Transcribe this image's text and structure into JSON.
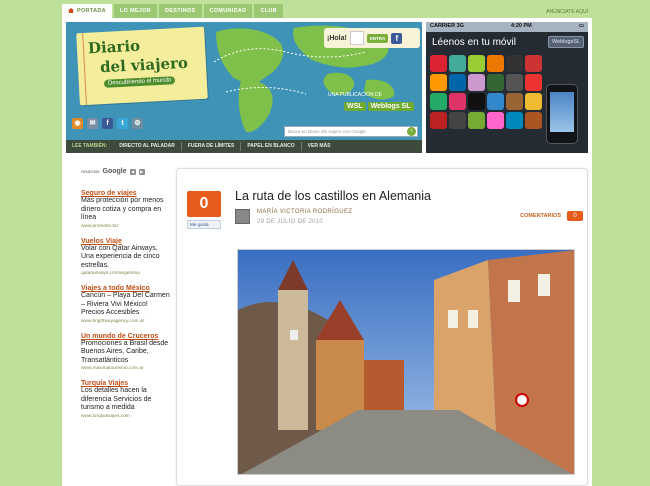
{
  "topnav": {
    "tabs": [
      "PORTADA",
      "LO MEJOR",
      "DESTINOS",
      "COMUNIDAD",
      "CLUB"
    ],
    "anuncia": "ANÚNCIATE AQUÍ"
  },
  "header": {
    "logo_line1": "Diario",
    "logo_line2": "del viajero",
    "tagline": "Descubriendo el mundo",
    "hola": "¡Hola!",
    "entra": "ENTRA",
    "publicacion": "UNA PUBLICACIÓN DE",
    "wsl": "WSL",
    "weblogs": "Weblogs SL",
    "search_placeholder": "Busca en Diario del viajero con Google",
    "colors": {
      "header_bg": "#3f93b6",
      "land": "#7ec04a",
      "notepad": "#f4ee9c"
    }
  },
  "mobile": {
    "carrier": "CARRIER 3G",
    "time": "4:20 PM",
    "title": "Léenos en tu móvil",
    "button": "WeblogsSL"
  },
  "subnav": {
    "lee": "LEE TAMBIÉN:",
    "items": [
      "DIRECTO AL PALADAR",
      "FUERA DE LÍMITES",
      "PAPEL EN BLANCO",
      "VER MÁS"
    ]
  },
  "sidebar": {
    "ads_label": "Anuncios",
    "google": "Google",
    "ads": [
      {
        "title": "Seguro de viajes",
        "desc": "Más protección por menos dinero cotiza y compra en línea",
        "url": "www.promofin.biz"
      },
      {
        "title": "Vuelos Viaje",
        "desc": "Volar con Qatar Airways. Una experiencia de cinco estrellas.",
        "url": "qatarairways.com/argentina"
      },
      {
        "title": "Viajes a todo México",
        "desc": "Cancún – Playa Del Carmen – Riviera Vivi México! Precios Accesibles",
        "url": "www.brightwayagency.com.ar"
      },
      {
        "title": "Un mundo de Cruceros",
        "desc": "Promociones a Brasil desde Buenos Aires, Caribe, Transatlánticos",
        "url": "www.maximatourismo.com.ar"
      },
      {
        "title": "Turquía Viajes",
        "desc": "Los detalles hacen la diferencia Servicios de turismo a medida",
        "url": "www.turquiaviajes.com"
      }
    ]
  },
  "article": {
    "count": "0",
    "like": "Me gusta",
    "title": "La ruta de los castillos en Alemania",
    "author": "MARÍA VICTORIA RODRÍGUEZ",
    "date": "29 DE JULIO DE 2010",
    "comments_label": "COMENTARIOS",
    "comments_count": "0"
  }
}
